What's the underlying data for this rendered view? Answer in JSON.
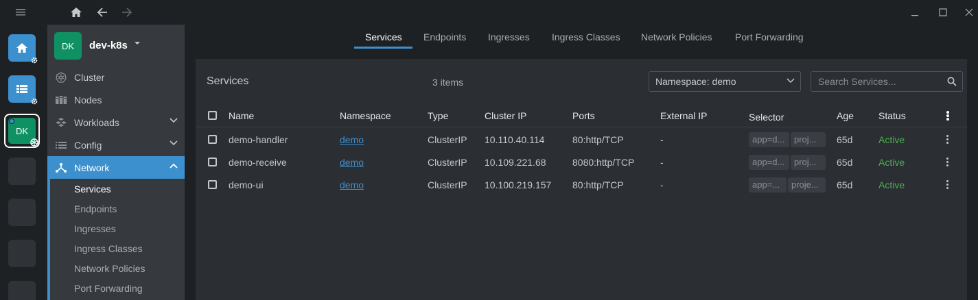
{
  "colors": {
    "accent": "#3d90ce",
    "cluster_green": "#0f9164",
    "status_active": "#4caf50"
  },
  "titlebar": {
    "menu_icon": "hamburger-icon",
    "home_icon": "home-icon",
    "back_icon": "arrow-left-icon",
    "forward_icon": "arrow-right-icon",
    "minimize_icon": "minimize-icon",
    "maximize_icon": "maximize-icon",
    "close_icon": "close-icon"
  },
  "hotbar": {
    "items": [
      {
        "icon": "home-icon",
        "badge": "gear-icon"
      },
      {
        "icon": "catalog-icon",
        "badge": "gear-icon"
      },
      {
        "label": "DK",
        "badge": "kubernetes-icon"
      }
    ]
  },
  "sidebar": {
    "cluster": {
      "avatar": "DK",
      "name": "dev-k8s"
    },
    "items": [
      {
        "label": "Cluster",
        "icon": "kubernetes-icon"
      },
      {
        "label": "Nodes",
        "icon": "nodes-icon"
      },
      {
        "label": "Workloads",
        "icon": "workloads-icon"
      },
      {
        "label": "Config",
        "icon": "config-icon"
      },
      {
        "label": "Network",
        "icon": "network-icon"
      }
    ],
    "network_sub": [
      {
        "label": "Services"
      },
      {
        "label": "Endpoints"
      },
      {
        "label": "Ingresses"
      },
      {
        "label": "Ingress Classes"
      },
      {
        "label": "Network Policies"
      },
      {
        "label": "Port Forwarding"
      }
    ]
  },
  "tabs": [
    {
      "label": "Services"
    },
    {
      "label": "Endpoints"
    },
    {
      "label": "Ingresses"
    },
    {
      "label": "Ingress Classes"
    },
    {
      "label": "Network Policies"
    },
    {
      "label": "Port Forwarding"
    }
  ],
  "panel": {
    "title": "Services",
    "count": "3 items",
    "namespace_select": "Namespace: demo",
    "search_placeholder": "Search Services..."
  },
  "table": {
    "columns": [
      "Name",
      "Namespace",
      "Type",
      "Cluster IP",
      "Ports",
      "External IP",
      "Selector",
      "Age",
      "Status"
    ],
    "rows": [
      {
        "name": "demo-handler",
        "namespace": "demo",
        "type": "ClusterIP",
        "cluster_ip": "10.110.40.114",
        "ports": "80:http/TCP",
        "external_ip": "-",
        "selector_1": "app=d...",
        "selector_2": "proj...",
        "age": "65d",
        "status": "Active"
      },
      {
        "name": "demo-receive",
        "namespace": "demo",
        "type": "ClusterIP",
        "cluster_ip": "10.109.221.68",
        "ports": "8080:http/TCP",
        "external_ip": "-",
        "selector_1": "app=d...",
        "selector_2": "proj...",
        "age": "65d",
        "status": "Active"
      },
      {
        "name": "demo-ui",
        "namespace": "demo",
        "type": "ClusterIP",
        "cluster_ip": "10.100.219.157",
        "ports": "80:http/TCP",
        "external_ip": "-",
        "selector_1": "app=...",
        "selector_2": "proje...",
        "age": "65d",
        "status": "Active"
      }
    ]
  }
}
